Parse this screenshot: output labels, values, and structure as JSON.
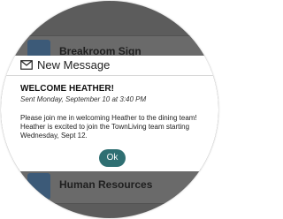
{
  "background": {
    "items": [
      {
        "label": "Breakroom Sign"
      },
      {
        "label": "Human Resources"
      }
    ]
  },
  "modal": {
    "title": "New Message",
    "icon": "envelope-icon",
    "heading": "WELCOME HEATHER!",
    "meta": "Sent Monday, September 10 at 3:40 PM",
    "body": "Please join me in welcoming Heather to the dining team! Heather is excited to join the TownLiving team starting Wednesday, Sept 12.",
    "ok_label": "Ok"
  },
  "colors": {
    "accent": "#2f6f72",
    "overlay": "#5c5c5c"
  }
}
